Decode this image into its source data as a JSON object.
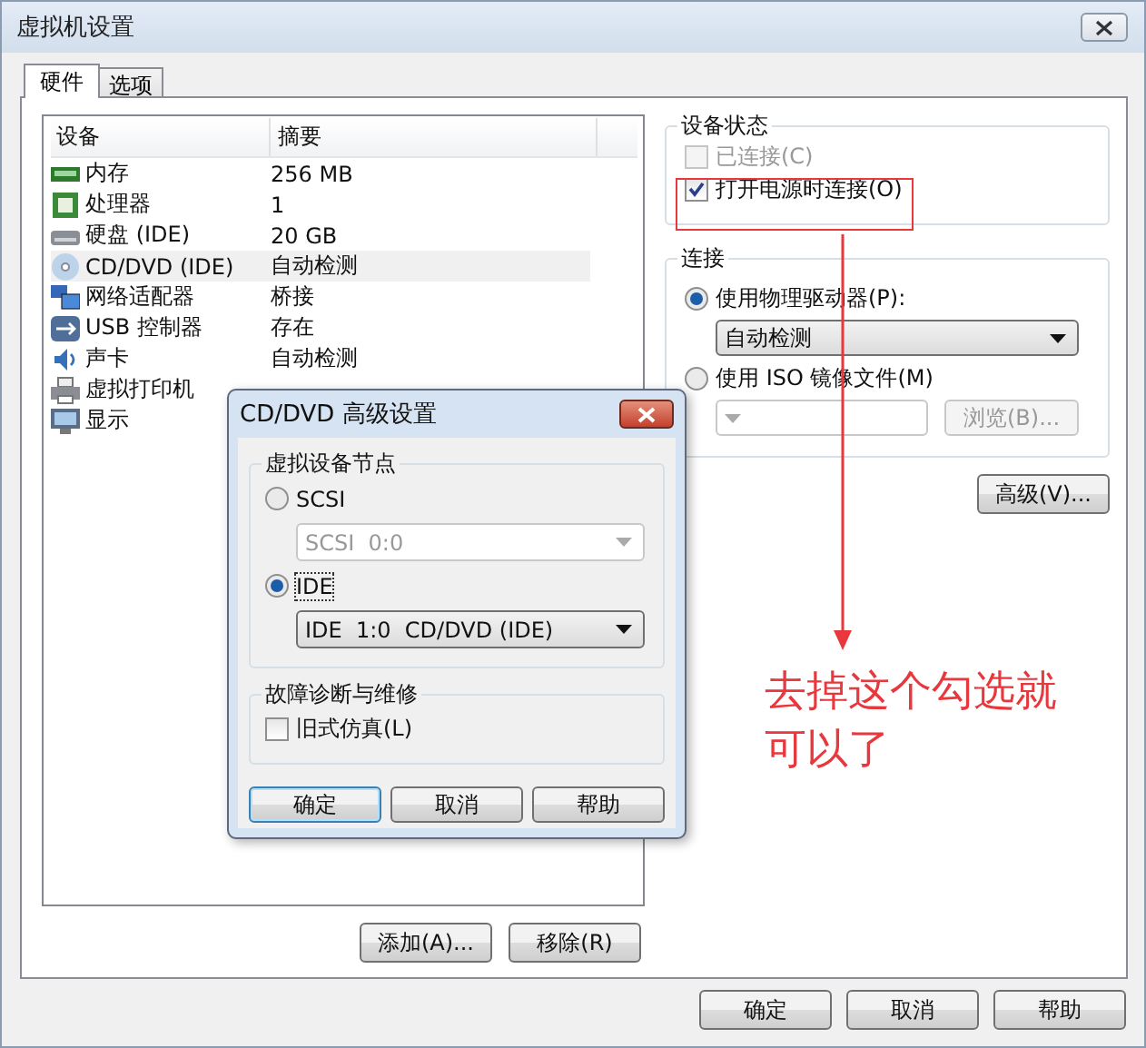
{
  "window": {
    "title": "虚拟机设置"
  },
  "tabs": [
    {
      "label": "硬件",
      "selected": true
    },
    {
      "label": "选项",
      "selected": false
    }
  ],
  "devices": {
    "columns": [
      "设备",
      "摘要"
    ],
    "rows": [
      {
        "kind": "memory",
        "name": "内存",
        "summary": "256 MB",
        "selected": false
      },
      {
        "kind": "cpu",
        "name": "处理器",
        "summary": "1",
        "selected": false
      },
      {
        "kind": "disk",
        "name": "硬盘 (IDE)",
        "summary": "20 GB",
        "selected": false
      },
      {
        "kind": "cd",
        "name": "CD/DVD (IDE)",
        "summary": "自动检测",
        "selected": true
      },
      {
        "kind": "network",
        "name": "网络适配器",
        "summary": "桥接",
        "selected": false
      },
      {
        "kind": "usb",
        "name": "USB 控制器",
        "summary": "存在",
        "selected": false
      },
      {
        "kind": "sound",
        "name": "声卡",
        "summary": "自动检测",
        "selected": false
      },
      {
        "kind": "printer",
        "name": "虚拟打印机",
        "selected": false
      },
      {
        "kind": "display",
        "name": "显示",
        "selected": false
      }
    ]
  },
  "list_buttons": [
    "添加(A)...",
    "移除(R)"
  ],
  "device_status": {
    "title": "设备状态",
    "checkboxes": [
      {
        "label": "已连接(C)",
        "checked": false,
        "disabled": true
      },
      {
        "label": "打开电源时连接(O)",
        "checked": true,
        "disabled": false
      }
    ]
  },
  "connection": {
    "title": "连接",
    "options": [
      {
        "label": "使用物理驱动器(P):",
        "selected": true,
        "dropdown": {
          "value": "自动检测",
          "disabled": false
        }
      },
      {
        "label": "使用 ISO 镜像文件(M)",
        "selected": false,
        "dropdown": {
          "disabled": true
        },
        "browse": "浏览(B)..."
      }
    ]
  },
  "advanced_button": "高级(V)...",
  "footer_buttons": [
    "确定",
    "取消",
    "帮助"
  ],
  "dialog": {
    "title": "CD/DVD 高级设置",
    "node_group": {
      "title": "虚拟设备节点",
      "options": [
        {
          "label": "SCSI",
          "selected": false,
          "dropdown": {
            "value": "SCSI  0:0",
            "disabled": true
          }
        },
        {
          "label": "IDE",
          "selected": true,
          "dropdown": {
            "value": "IDE  1:0  CD/DVD (IDE)",
            "disabled": false
          }
        }
      ]
    },
    "troubleshoot": {
      "title": "故障诊断与维修",
      "checkbox": {
        "label": "旧式仿真(L)",
        "checked": false
      }
    },
    "buttons": [
      "确定",
      "取消",
      "帮助"
    ]
  },
  "annotation": {
    "text": "去掉这个勾选就可以了"
  }
}
